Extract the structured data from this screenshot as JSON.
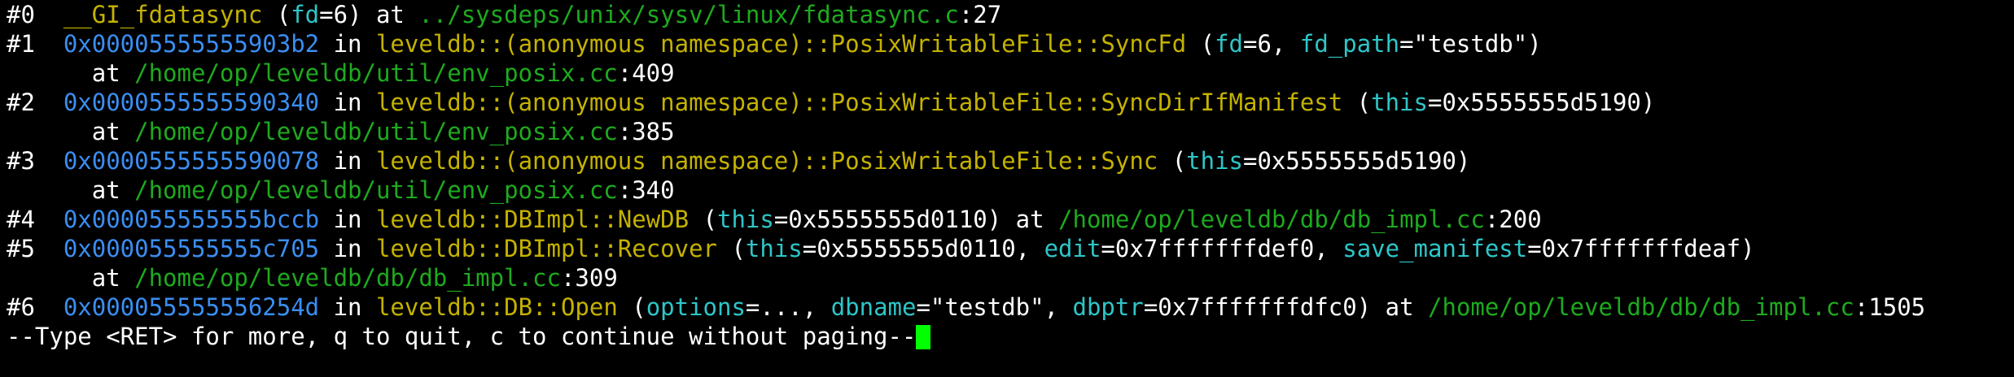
{
  "colors": {
    "background": "#000000",
    "text": "#ffffff",
    "function": "#c4b200",
    "address": "#3a8ef2",
    "path": "#1eaa1e",
    "argument": "#2ec6c8",
    "cursor": "#00ff00"
  },
  "frames": [
    {
      "num": "#0",
      "lines": [
        [
          {
            "t": "  ",
            "c": "w"
          },
          {
            "t": "__GI_fdatasync",
            "c": "fn"
          },
          {
            "t": " (",
            "c": "w"
          },
          {
            "t": "fd",
            "c": "ar"
          },
          {
            "t": "=6) at ",
            "c": "w"
          },
          {
            "t": "../sysdeps/unix/sysv/linux/fdatasync.c",
            "c": "pa"
          },
          {
            "t": ":27",
            "c": "w"
          }
        ]
      ]
    },
    {
      "num": "#1",
      "lines": [
        [
          {
            "t": "  ",
            "c": "w"
          },
          {
            "t": "0x00005555555903b2",
            "c": "ad"
          },
          {
            "t": " in ",
            "c": "w"
          },
          {
            "t": "leveldb::(anonymous namespace)::PosixWritableFile::SyncFd",
            "c": "fn"
          },
          {
            "t": " (",
            "c": "w"
          },
          {
            "t": "fd",
            "c": "ar"
          },
          {
            "t": "=6, ",
            "c": "w"
          },
          {
            "t": "fd_path",
            "c": "ar"
          },
          {
            "t": "=\"testdb\")",
            "c": "w"
          }
        ],
        [
          {
            "t": "    at ",
            "c": "w"
          },
          {
            "t": "/home/op/leveldb/util/env_posix.cc",
            "c": "pa"
          },
          {
            "t": ":409",
            "c": "w"
          }
        ]
      ]
    },
    {
      "num": "#2",
      "lines": [
        [
          {
            "t": "  ",
            "c": "w"
          },
          {
            "t": "0x0000555555590340",
            "c": "ad"
          },
          {
            "t": " in ",
            "c": "w"
          },
          {
            "t": "leveldb::(anonymous namespace)::PosixWritableFile::SyncDirIfManifest",
            "c": "fn"
          },
          {
            "t": " (",
            "c": "w"
          },
          {
            "t": "this",
            "c": "ar"
          },
          {
            "t": "=0x5555555d5190)",
            "c": "w"
          }
        ],
        [
          {
            "t": "    at ",
            "c": "w"
          },
          {
            "t": "/home/op/leveldb/util/env_posix.cc",
            "c": "pa"
          },
          {
            "t": ":385",
            "c": "w"
          }
        ]
      ]
    },
    {
      "num": "#3",
      "lines": [
        [
          {
            "t": "  ",
            "c": "w"
          },
          {
            "t": "0x0000555555590078",
            "c": "ad"
          },
          {
            "t": " in ",
            "c": "w"
          },
          {
            "t": "leveldb::(anonymous namespace)::PosixWritableFile::Sync",
            "c": "fn"
          },
          {
            "t": " (",
            "c": "w"
          },
          {
            "t": "this",
            "c": "ar"
          },
          {
            "t": "=0x5555555d5190)",
            "c": "w"
          }
        ],
        [
          {
            "t": "    at ",
            "c": "w"
          },
          {
            "t": "/home/op/leveldb/util/env_posix.cc",
            "c": "pa"
          },
          {
            "t": ":340",
            "c": "w"
          }
        ]
      ]
    },
    {
      "num": "#4",
      "lines": [
        [
          {
            "t": "  ",
            "c": "w"
          },
          {
            "t": "0x000055555555bccb",
            "c": "ad"
          },
          {
            "t": " in ",
            "c": "w"
          },
          {
            "t": "leveldb::DBImpl::NewDB",
            "c": "fn"
          },
          {
            "t": " (",
            "c": "w"
          },
          {
            "t": "this",
            "c": "ar"
          },
          {
            "t": "=0x5555555d0110) at ",
            "c": "w"
          },
          {
            "t": "/home/op/leveldb/db/db_impl.cc",
            "c": "pa"
          },
          {
            "t": ":200",
            "c": "w"
          }
        ]
      ]
    },
    {
      "num": "#5",
      "lines": [
        [
          {
            "t": "  ",
            "c": "w"
          },
          {
            "t": "0x000055555555c705",
            "c": "ad"
          },
          {
            "t": " in ",
            "c": "w"
          },
          {
            "t": "leveldb::DBImpl::Recover",
            "c": "fn"
          },
          {
            "t": " (",
            "c": "w"
          },
          {
            "t": "this",
            "c": "ar"
          },
          {
            "t": "=0x5555555d0110, ",
            "c": "w"
          },
          {
            "t": "edit",
            "c": "ar"
          },
          {
            "t": "=0x7fffffffdef0, ",
            "c": "w"
          },
          {
            "t": "save_manifest",
            "c": "ar"
          },
          {
            "t": "=0x7fffffffdeaf)",
            "c": "w"
          }
        ],
        [
          {
            "t": "    at ",
            "c": "w"
          },
          {
            "t": "/home/op/leveldb/db/db_impl.cc",
            "c": "pa"
          },
          {
            "t": ":309",
            "c": "w"
          }
        ]
      ]
    },
    {
      "num": "#6",
      "lines": [
        [
          {
            "t": "  ",
            "c": "w"
          },
          {
            "t": "0x000055555556254d",
            "c": "ad"
          },
          {
            "t": " in ",
            "c": "w"
          },
          {
            "t": "leveldb::DB::Open",
            "c": "fn"
          },
          {
            "t": " (",
            "c": "w"
          },
          {
            "t": "options",
            "c": "ar"
          },
          {
            "t": "=..., ",
            "c": "w"
          },
          {
            "t": "dbname",
            "c": "ar"
          },
          {
            "t": "=\"testdb\", ",
            "c": "w"
          },
          {
            "t": "dbptr",
            "c": "ar"
          },
          {
            "t": "=0x7fffffffdfc0) at ",
            "c": "w"
          },
          {
            "t": "/home/op/leveldb/db/db_impl.cc",
            "c": "pa"
          },
          {
            "t": ":1505",
            "c": "w"
          }
        ]
      ]
    }
  ],
  "pager_prompt": "--Type <RET> for more, q to quit, c to continue without paging--"
}
